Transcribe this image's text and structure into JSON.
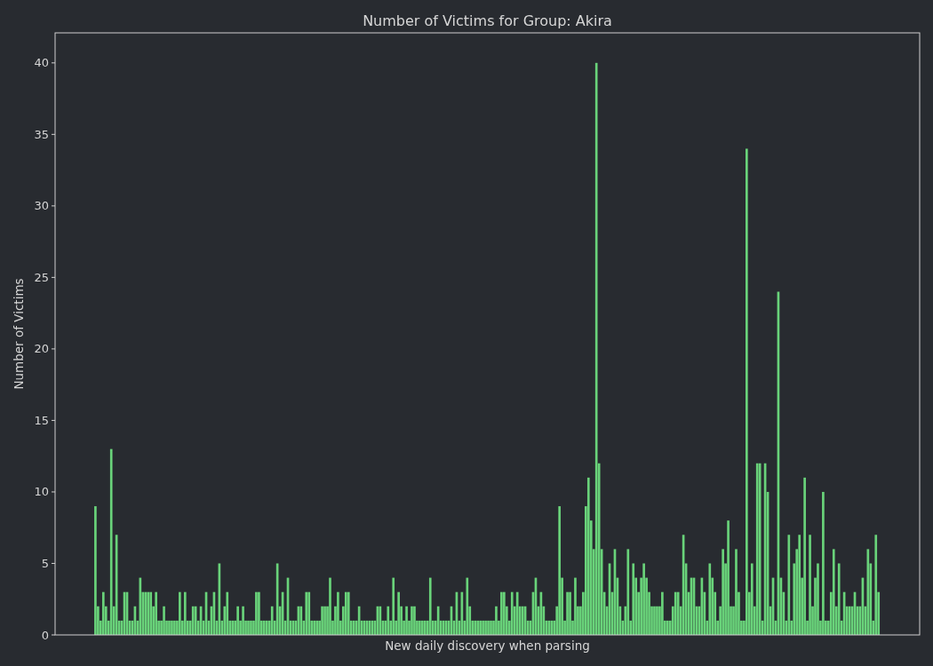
{
  "chart_data": {
    "type": "bar",
    "title": "Number of Victims for Group: Akira",
    "xlabel": "New daily discovery when parsing",
    "ylabel": "Number of Victims",
    "series": [
      {
        "color": "#69d37a",
        "values": [
          9,
          2,
          1,
          3,
          2,
          1,
          13,
          2,
          7,
          1,
          1,
          3,
          3,
          1,
          1,
          2,
          1,
          4,
          3,
          3,
          3,
          3,
          2,
          3,
          1,
          1,
          2,
          1,
          1,
          1,
          1,
          1,
          3,
          1,
          3,
          1,
          1,
          2,
          2,
          1,
          2,
          1,
          3,
          1,
          2,
          3,
          1,
          5,
          1,
          2,
          3,
          1,
          1,
          1,
          2,
          1,
          2,
          1,
          1,
          1,
          1,
          3,
          3,
          1,
          1,
          1,
          1,
          2,
          1,
          5,
          2,
          3,
          1,
          4,
          1,
          1,
          1,
          2,
          2,
          1,
          3,
          3,
          1,
          1,
          1,
          1,
          2,
          2,
          2,
          4,
          1,
          2,
          3,
          1,
          2,
          3,
          3,
          1,
          1,
          1,
          2,
          1,
          1,
          1,
          1,
          1,
          1,
          2,
          2,
          1,
          1,
          2,
          1,
          4,
          1,
          3,
          2,
          1,
          2,
          1,
          2,
          2,
          1,
          1,
          1,
          1,
          1,
          4,
          1,
          1,
          2,
          1,
          1,
          1,
          1,
          2,
          1,
          3,
          1,
          3,
          1,
          4,
          2,
          1,
          1,
          1,
          1,
          1,
          1,
          1,
          1,
          1,
          2,
          1,
          3,
          3,
          2,
          1,
          3,
          2,
          3,
          2,
          2,
          2,
          1,
          1,
          3,
          4,
          2,
          3,
          2,
          1,
          1,
          1,
          1,
          2,
          9,
          4,
          1,
          3,
          3,
          1,
          4,
          2,
          2,
          3,
          9,
          11,
          8,
          6,
          40,
          12,
          6,
          3,
          2,
          5,
          3,
          6,
          4,
          2,
          1,
          2,
          6,
          1,
          5,
          4,
          3,
          4,
          5,
          4,
          3,
          2,
          2,
          2,
          2,
          3,
          1,
          1,
          1,
          2,
          3,
          3,
          2,
          7,
          5,
          3,
          4,
          4,
          2,
          2,
          4,
          3,
          1,
          5,
          4,
          3,
          1,
          2,
          6,
          5,
          8,
          2,
          2,
          6,
          3,
          1,
          1,
          34,
          3,
          5,
          2,
          12,
          12,
          1,
          12,
          10,
          2,
          4,
          1,
          24,
          4,
          3,
          1,
          7,
          1,
          5,
          6,
          7,
          4,
          11,
          1,
          7,
          2,
          4,
          5,
          1,
          10,
          1,
          1,
          3,
          6,
          2,
          5,
          1,
          3,
          2,
          2,
          2,
          3,
          2,
          2,
          4,
          2,
          6,
          5,
          1,
          7,
          3
        ]
      }
    ],
    "ylim": [
      0,
      42.1
    ],
    "yticks": [
      0,
      5,
      10,
      15,
      20,
      25,
      30,
      35,
      40
    ]
  }
}
